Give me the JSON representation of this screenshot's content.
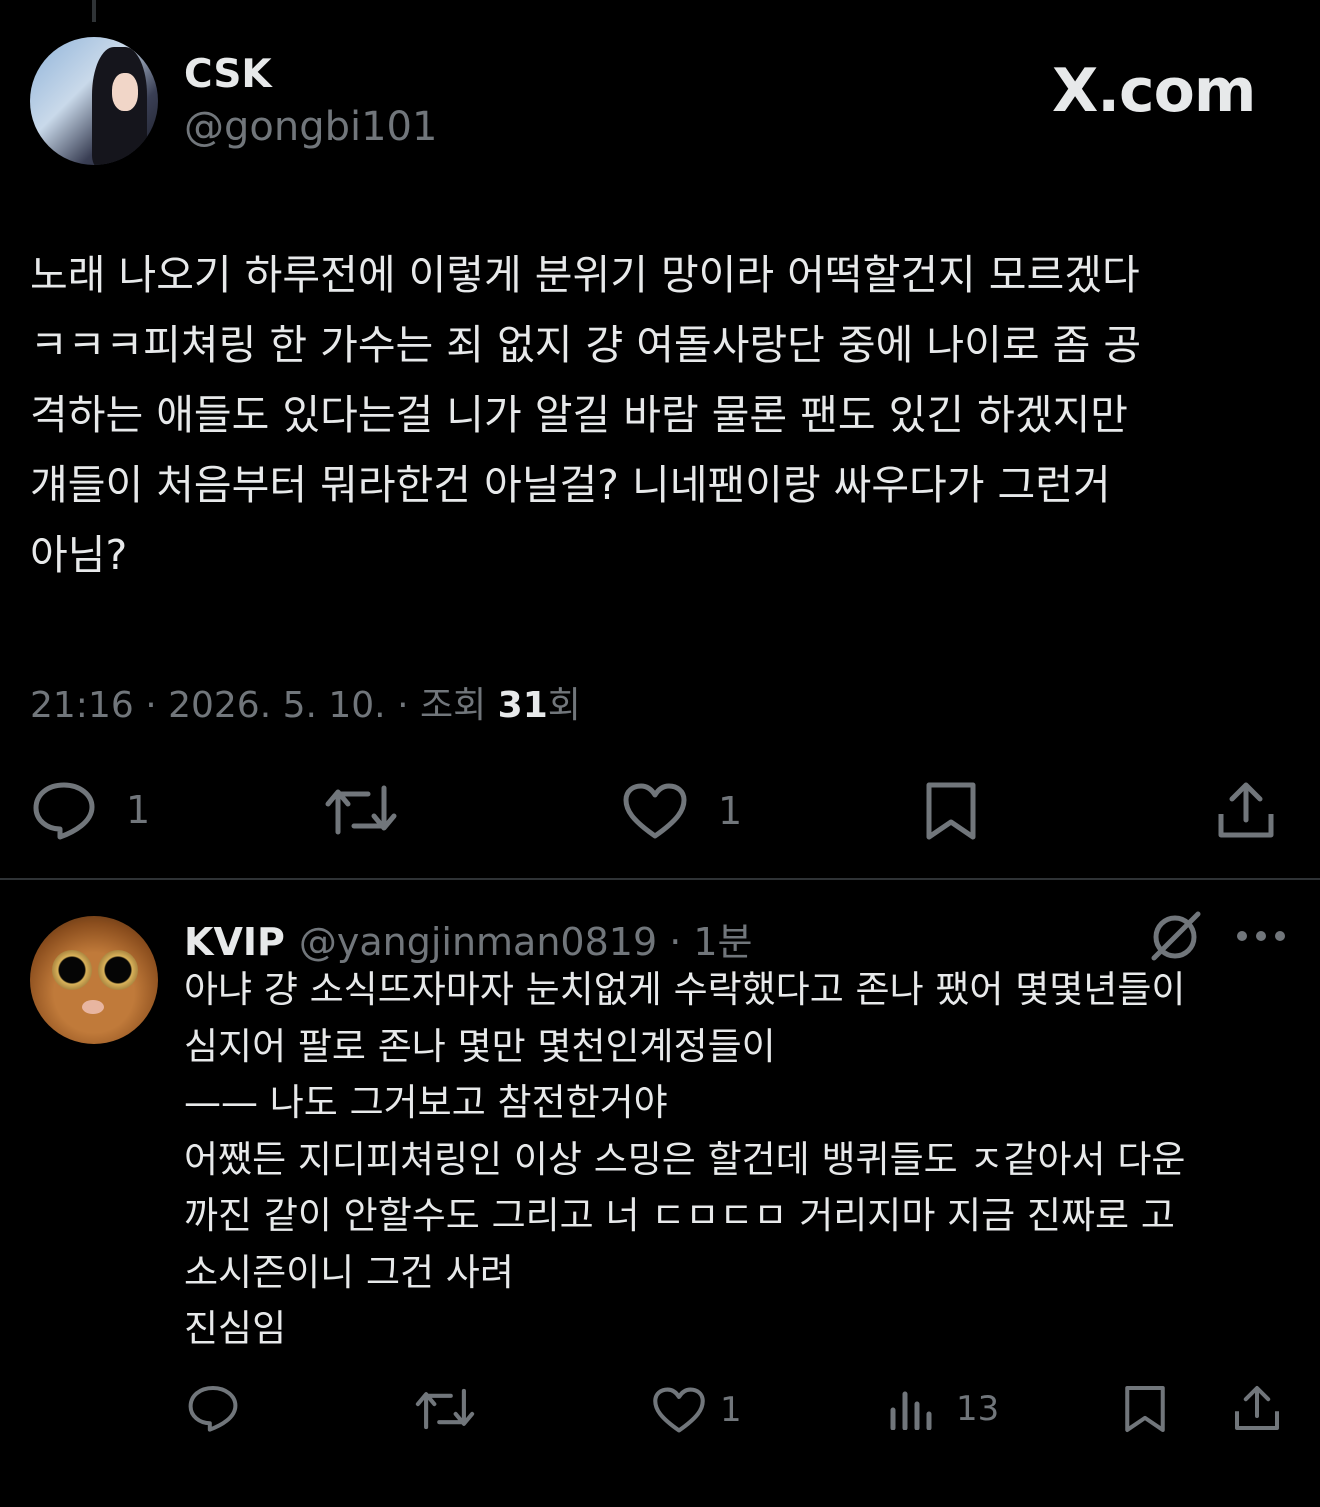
{
  "brand": {
    "watermark": "X.com"
  },
  "main_tweet": {
    "name": "CSK",
    "handle": "@gongbi101",
    "lines": [
      "노래 나오기 하루전에 이렇게 분위기 망이라 어떡할건지 모르겠다",
      "ㅋㅋㅋ피쳐링 한 가수는 죄 없지 걍 여돌사랑단 중에 나이로 좀 공",
      "격하는 애들도 있다는걸 니가 알길 바람 물론 팬도 있긴 하겠지만",
      "걔들이 처음부터 뭐라한건 아닐걸? 니네팬이랑 싸우다가 그런거",
      "아님?"
    ],
    "time": "21:16 · 2026. 5. 10. · 조회 ",
    "views": "31",
    "views_suffix": "회",
    "actions": {
      "reply_count": "1",
      "like_count": "1"
    }
  },
  "reply": {
    "name": "KVIP",
    "handle": "@yangjinman0819 · 1분",
    "lines": [
      "아냐 걍 소식뜨자마자 눈치없게 수락했다고 존나 팼어 몇몇년들이",
      "심지어 팔로 존나 몇만 몇천인계정들이",
      "—— 나도 그거보고 참전한거야",
      "어쨌든 지디피쳐링인 이상 스밍은 할건데 뱅퀴들도 ㅈ같아서 다운",
      "까진 같이 안할수도 그리고 너 ㄷㅁㄷㅁ 거리지마 지금 진짜로 고",
      "소시즌이니 그건 사려",
      "진심임"
    ],
    "actions": {
      "like_count": "1",
      "view_count": "13"
    }
  },
  "colors": {
    "background": "#000000",
    "text": "#e7e9ea",
    "muted": "#71767b",
    "divider": "#2f3336"
  }
}
